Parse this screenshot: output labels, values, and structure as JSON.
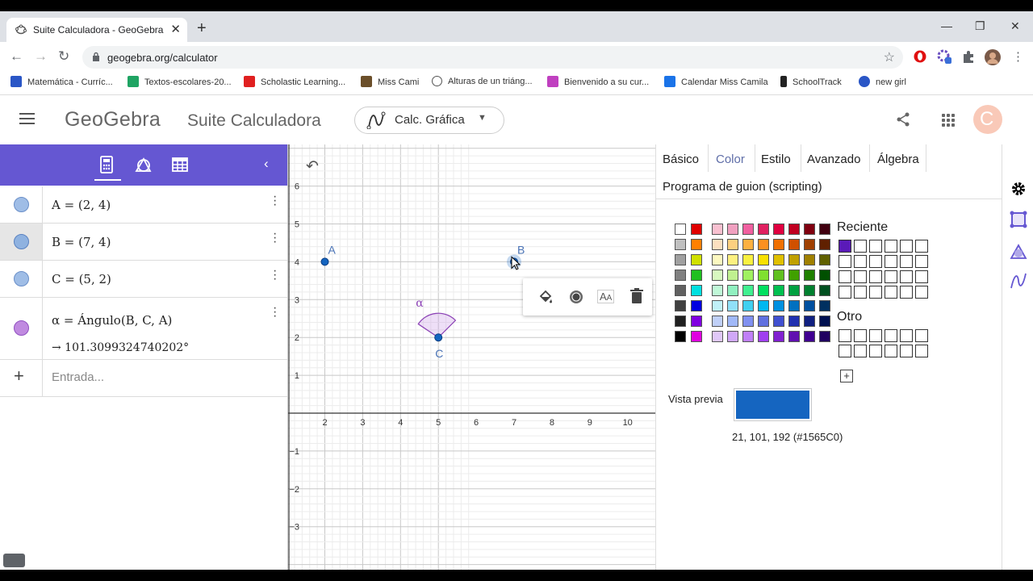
{
  "browser": {
    "tab_title": "Suite Calculadora - GeoGebra",
    "tab_close": "✕",
    "new_tab": "+",
    "url": "geogebra.org/calculator",
    "window_controls": [
      "—",
      "❐",
      "✕"
    ],
    "nav": {
      "back": "←",
      "forward": "→",
      "reload": "↻"
    },
    "star": "☆",
    "bookmarks": [
      {
        "label": "Matemática - Curríc...",
        "color": "#2a56c6"
      },
      {
        "label": "Textos-escolares-20...",
        "color": "#1fa463"
      },
      {
        "label": "Scholastic Learning...",
        "color": "#e02020"
      },
      {
        "label": "Miss Cami",
        "color": "#6b4f2a"
      },
      {
        "label": "Alturas de un triáng...",
        "color": "#555555"
      },
      {
        "label": "Bienvenido a su cur...",
        "color": "#c040c0"
      },
      {
        "label": "Calendar Miss Camila",
        "color": "#1a73e8"
      },
      {
        "label": "SchoolTrack",
        "color": "#222222"
      },
      {
        "label": "new girl",
        "color": "#2a56c6"
      }
    ]
  },
  "header": {
    "logo": "GeoGebra",
    "title": "Suite Calculadora",
    "app_select": "Calc. Gráfica",
    "avatar_letter": "C"
  },
  "algebra": {
    "collapse": "‹",
    "rows": [
      {
        "expr": "A = (2, 4)",
        "color": "#9fbde6",
        "selected": false
      },
      {
        "expr": "B = (7, 4)",
        "color": "#8fb2e0",
        "selected": true
      },
      {
        "expr": "C = (5, 2)",
        "color": "#9fbde6",
        "selected": false
      },
      {
        "expr": "α = Ángulo(B, C, A)",
        "result": "→  101.3099324740202°",
        "color": "#c08ae0",
        "selected": false
      }
    ],
    "input_placeholder": "Entrada...",
    "plus": "+"
  },
  "graph": {
    "x_ticks": [
      "2",
      "3",
      "4",
      "5",
      "6",
      "7",
      "8",
      "9",
      "10"
    ],
    "y_ticks": [
      "6",
      "5",
      "4",
      "3",
      "2",
      "1",
      "−1",
      "−2",
      "−3"
    ],
    "points": [
      {
        "label": "A",
        "x": 2,
        "y": 4
      },
      {
        "label": "B",
        "x": 7,
        "y": 4
      },
      {
        "label": "C",
        "x": 5,
        "y": 2
      }
    ],
    "angle_label": "α",
    "point_color": "#1565c0",
    "label_color": "#4a73b6",
    "angle_color": "#8a3fb5"
  },
  "properties": {
    "tabs": [
      "Básico",
      "Color",
      "Estilo",
      "Avanzado",
      "Álgebra"
    ],
    "active_tab": "Color",
    "tab2": "Programa de guion (scripting)",
    "close": "✕",
    "recent_label": "Reciente",
    "other_label": "Otro",
    "add_custom": "+",
    "preview_label": "Vista previa",
    "preview_color": "#1565C0",
    "preview_value": "21, 101, 192 (#1565C0)",
    "recent_first": "#5a1ab8",
    "palette_left": [
      [
        "#ffffff",
        "#e00000"
      ],
      [
        "#c0c0c0",
        "#ff8000"
      ],
      [
        "#a0a0a0",
        "#d0e000"
      ],
      [
        "#808080",
        "#20c020"
      ],
      [
        "#606060",
        "#00e0e0"
      ],
      [
        "#404040",
        "#0000e0"
      ],
      [
        "#202020",
        "#8000e0"
      ],
      [
        "#000000",
        "#e000e0"
      ]
    ],
    "palette_main": [
      [
        "#f8c0d0",
        "#f0a0c0",
        "#f060a0",
        "#e02060",
        "#e00040",
        "#c00020",
        "#800010",
        "#400010"
      ],
      [
        "#fce0c0",
        "#fcd080",
        "#fcb040",
        "#fc9020",
        "#f07000",
        "#d05000",
        "#a04000",
        "#602000"
      ],
      [
        "#fcf8c0",
        "#fcf080",
        "#f8f040",
        "#f8e000",
        "#e0c000",
        "#c0a000",
        "#a08000",
        "#606000"
      ],
      [
        "#d8f8c0",
        "#c0f090",
        "#a0f060",
        "#80e030",
        "#60c020",
        "#40a000",
        "#208000",
        "#005000"
      ],
      [
        "#c0f8d8",
        "#90f0c0",
        "#40f090",
        "#00e060",
        "#00c050",
        "#00a040",
        "#008030",
        "#005020"
      ],
      [
        "#c0f0f8",
        "#90e0f8",
        "#40d0f0",
        "#00b8f0",
        "#0090e0",
        "#0070c0",
        "#0050a0",
        "#003060"
      ],
      [
        "#c0d0f8",
        "#a0b8f8",
        "#8090f0",
        "#6070e0",
        "#4050d0",
        "#2030b0",
        "#102080",
        "#001050"
      ],
      [
        "#e0c8f8",
        "#d0a8f8",
        "#c080f8",
        "#a040f0",
        "#8020d0",
        "#6010b0",
        "#400090",
        "#200060"
      ]
    ]
  }
}
